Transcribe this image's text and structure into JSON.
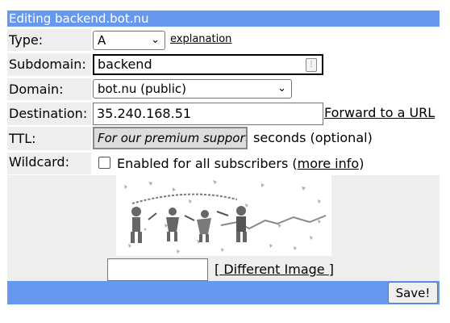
{
  "form": {
    "title": "Editing backend.bot.nu",
    "type": {
      "label": "Type:",
      "value": "A",
      "help_link": "explanation"
    },
    "subdomain": {
      "label": "Subdomain:",
      "value": "backend"
    },
    "domain": {
      "label": "Domain:",
      "value": "bot.nu (public)"
    },
    "destination": {
      "label": "Destination:",
      "value": "35.240.168.51",
      "forward_link": "Forward to a URL"
    },
    "ttl": {
      "label": "TTL:",
      "value": "For our premium support",
      "suffix": "seconds (optional)"
    },
    "wildcard": {
      "label": "Wildcard:",
      "checkbox_text": "Enabled for all subscribers (",
      "more_info": "more info",
      "close_paren": ")"
    },
    "captcha": {
      "bracket_open": "[",
      "different_image": " Different Image ",
      "bracket_close": "]"
    },
    "save_label": "Save!"
  },
  "colors": {
    "header_bar": "#6699ee",
    "label_bg": "#eeeeee"
  }
}
